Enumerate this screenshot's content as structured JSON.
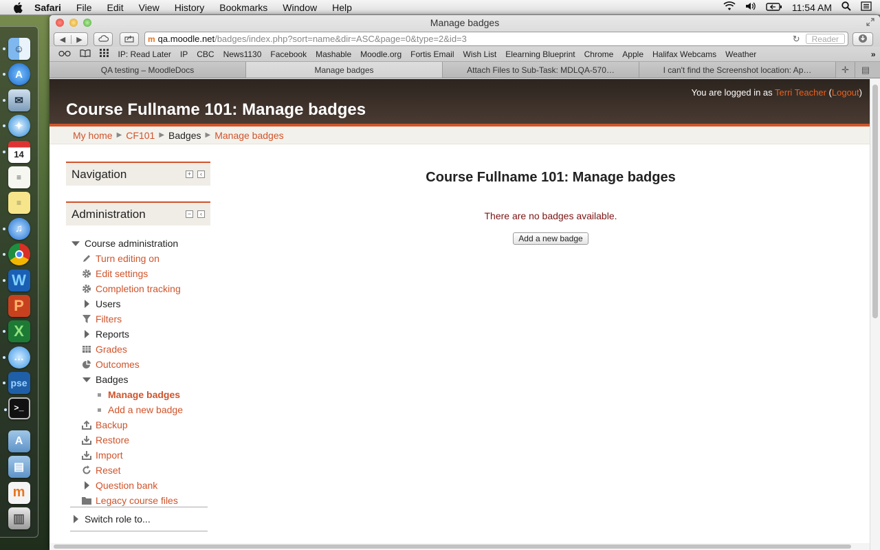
{
  "menubar": {
    "app": "Safari",
    "items": [
      "File",
      "Edit",
      "View",
      "History",
      "Bookmarks",
      "Window",
      "Help"
    ],
    "clock": "11:54 AM"
  },
  "browser": {
    "window_title": "Manage badges",
    "url_host": "qa.moodle.net",
    "url_path": "/badges/index.php?sort=name&dir=ASC&page=0&type=2&id=3",
    "reader": "Reader",
    "bookmarks": [
      "IP: Read Later",
      "IP",
      "CBC",
      "News1130",
      "Facebook",
      "Mashable",
      "Moodle.org",
      "Fortis Email",
      "Wish List",
      "Elearning Blueprint",
      "Chrome",
      "Apple",
      "Halifax Webcams",
      "Weather"
    ],
    "tabs": [
      "QA testing – MoodleDocs",
      "Manage badges",
      "Attach Files to Sub-Task: MDLQA-570…",
      "I can't find the Screenshot location: Ap…"
    ]
  },
  "page": {
    "site_title": "Course Fullname 101: Manage badges",
    "login_prefix": "You are logged in as ",
    "login_user": "Terri Teacher",
    "login_open": " (",
    "logout": "Logout",
    "login_close": ")",
    "breadcrumb": [
      "My home",
      "CF101",
      "Badges",
      "Manage badges"
    ],
    "navigation_title": "Navigation",
    "administration_title": "Administration",
    "admin_items": [
      {
        "label": "Course administration"
      },
      {
        "label": "Turn editing on"
      },
      {
        "label": "Edit settings"
      },
      {
        "label": "Completion tracking"
      },
      {
        "label": "Users"
      },
      {
        "label": "Filters"
      },
      {
        "label": "Reports"
      },
      {
        "label": "Grades"
      },
      {
        "label": "Outcomes"
      },
      {
        "label": "Badges"
      },
      {
        "label": "Manage badges"
      },
      {
        "label": "Add a new badge"
      },
      {
        "label": "Backup"
      },
      {
        "label": "Restore"
      },
      {
        "label": "Import"
      },
      {
        "label": "Reset"
      },
      {
        "label": "Question bank"
      },
      {
        "label": "Legacy course files"
      }
    ],
    "switch_role": "Switch role to...",
    "main_heading": "Course Fullname 101: Manage badges",
    "notice": "There are no badges available.",
    "add_button": "Add a new badge"
  },
  "colors": {
    "accent": "#d0532a",
    "header": "#3a2f28",
    "notice": "#7a1414"
  }
}
